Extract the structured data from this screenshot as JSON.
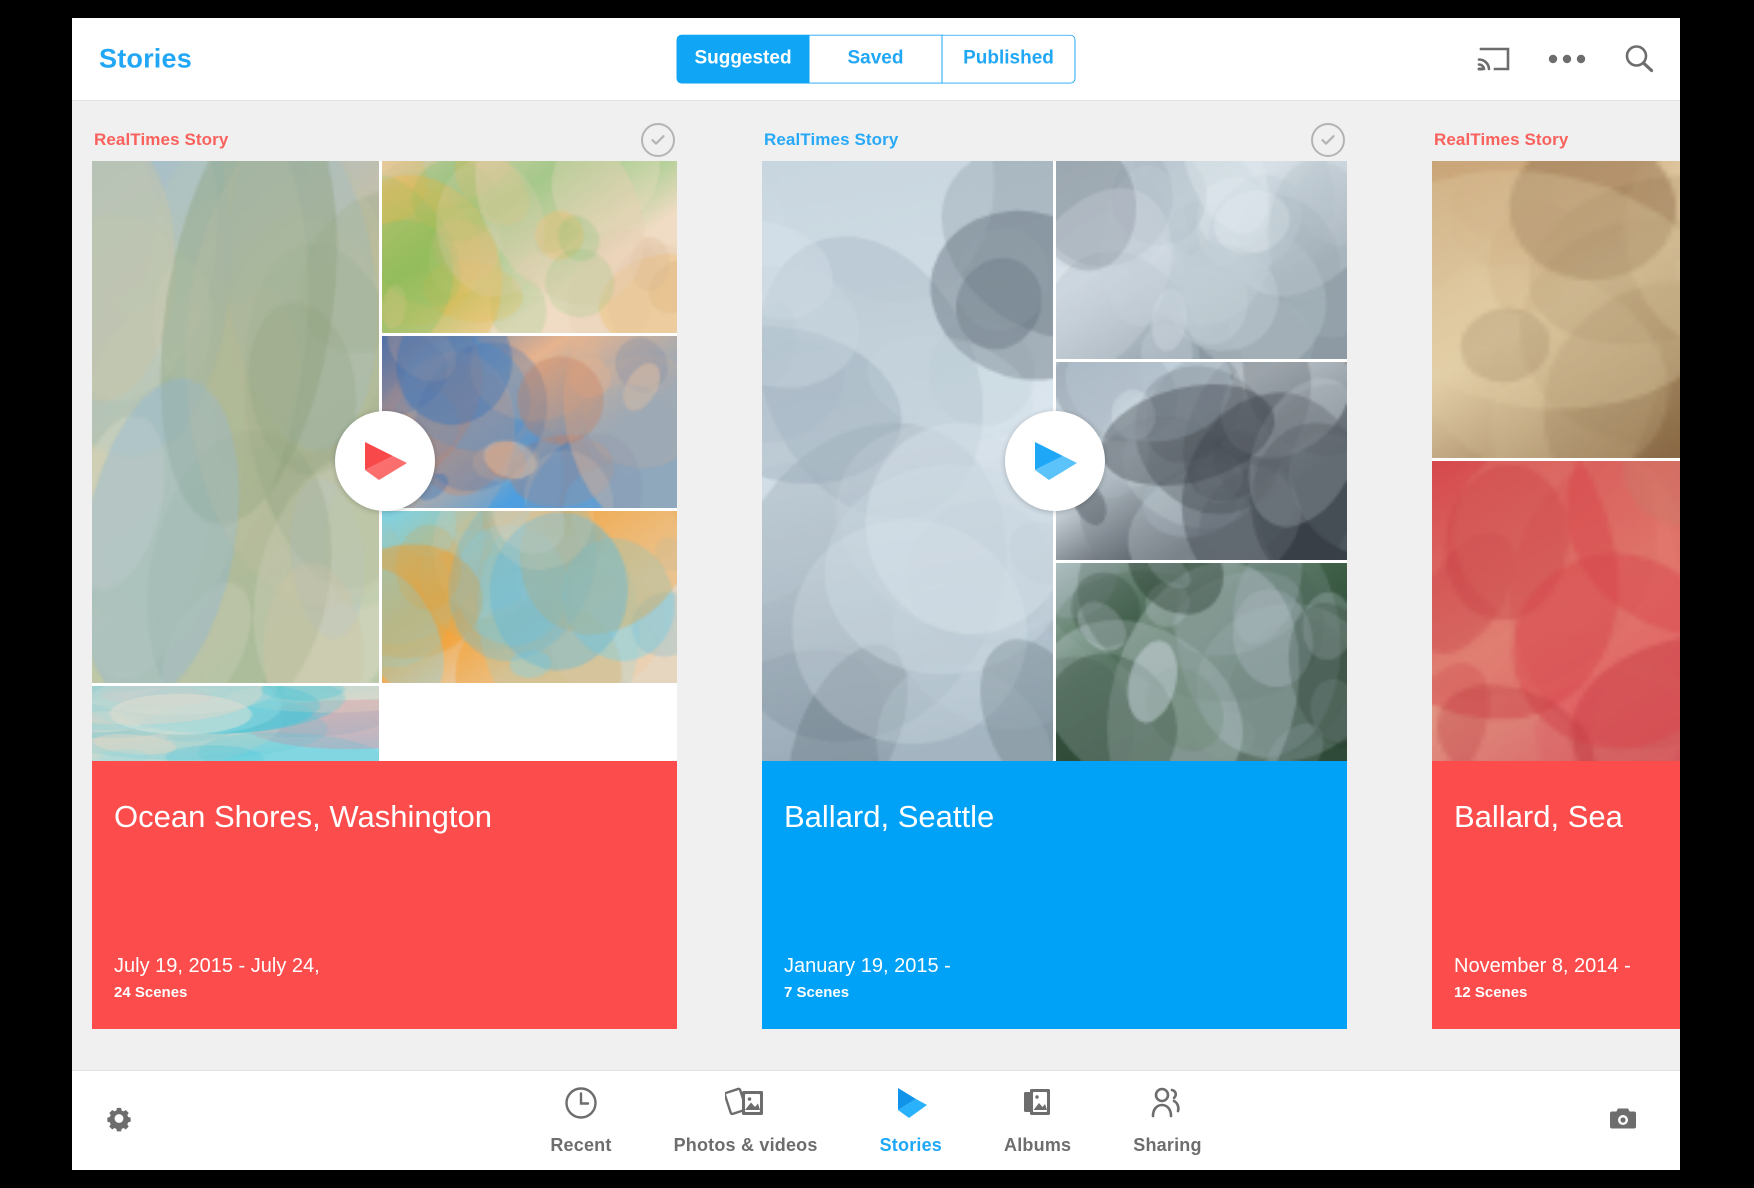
{
  "app": {
    "title": "Stories"
  },
  "tabs": [
    {
      "label": "Suggested",
      "active": true
    },
    {
      "label": "Saved",
      "active": false
    },
    {
      "label": "Published",
      "active": false
    }
  ],
  "appbar_icons": [
    {
      "name": "cast-icon"
    },
    {
      "name": "overflow-menu-icon"
    },
    {
      "name": "search-icon"
    }
  ],
  "colors": {
    "accent_blue": "#10a6f5",
    "title_blue": "#21a7f5",
    "story_red": "#fc4c4c",
    "story_blue": "#00a2f7",
    "kind_red": "#f9615d",
    "kind_blue": "#28a9f7",
    "icon_gray": "#6d6d6d",
    "page_bg": "#f0f0f0"
  },
  "stories": [
    {
      "kind": "RealTimes Story",
      "kind_color": "red",
      "has_check": true,
      "title": "Ocean Shores, Washington",
      "date": "July 19, 2015 - July 24,",
      "scenes": "24 Scenes",
      "caption_color": "red",
      "play_color": "#f9484a",
      "layout": "a",
      "tiles": [
        {
          "name": "beach-houses-dunes-photo",
          "palette": [
            "#8fb6d8",
            "#b9c9a8",
            "#cfc3a4",
            "#e7e0cf",
            "#7f9a74"
          ]
        },
        {
          "name": "girl-building-sandcastle-photo",
          "palette": [
            "#4fc6d8",
            "#8fdbe4",
            "#ead7c4",
            "#f2e5d6",
            "#e88ba0"
          ]
        },
        {
          "name": "sand-toys-bucket-shovel-photo",
          "palette": [
            "#e8cfb4",
            "#f0dcc4",
            "#6fc36a",
            "#f2b33b",
            "#d9b894"
          ]
        },
        {
          "name": "children-swimming-goggles-photo",
          "palette": [
            "#2a6fbf",
            "#4c9fe0",
            "#e8b48e",
            "#f0d0b0",
            "#c97a5a"
          ]
        },
        {
          "name": "kids-snorkels-floaties-photo",
          "palette": [
            "#7fd4e8",
            "#e7d6bf",
            "#f59a22",
            "#f2c79a",
            "#66b8d8"
          ]
        }
      ]
    },
    {
      "kind": "RealTimes Story",
      "kind_color": "blue",
      "has_check": true,
      "title": "Ballard, Seattle",
      "date": "January 19, 2015 -",
      "scenes": "7 Scenes",
      "caption_color": "blue",
      "play_color": "#1ea7f6",
      "layout": "b",
      "tiles": [
        {
          "name": "child-throwing-snowball-photo",
          "palette": [
            "#c8d6e0",
            "#9aabb8",
            "#dce6ee",
            "#5a6a74",
            "#b0bec8"
          ]
        },
        {
          "name": "snowman-with-scarf-photo",
          "palette": [
            "#c4d0d8",
            "#8d9aa3",
            "#e2eaf0",
            "#3f4a52",
            "#aab8c2"
          ]
        },
        {
          "name": "golden-retriever-running-snow-photo",
          "palette": [
            "#dce8f0",
            "#c08a4a",
            "#e8c28a",
            "#b4c6d2",
            "#8e6a3a"
          ]
        },
        {
          "name": "girl-hugging-dog-window-photo",
          "palette": [
            "#b8c8d4",
            "#3a4048",
            "#dce6ec",
            "#7a858e",
            "#545c64"
          ]
        },
        {
          "name": "child-by-pine-tree-snow-photo",
          "palette": [
            "#d4e0e8",
            "#2f4a38",
            "#46684e",
            "#aebcc6",
            "#1f3326"
          ]
        }
      ]
    },
    {
      "kind": "RealTimes Story",
      "kind_color": "red",
      "has_check": false,
      "title": "Ballard, Sea",
      "date": "November 8, 2014 -",
      "scenes": "12 Scenes",
      "caption_color": "red",
      "play_color": "#f9484a",
      "layout": "c",
      "tiles": [
        {
          "name": "family-thanksgiving-dinner-photo",
          "palette": [
            "#c9a478",
            "#8a6a46",
            "#e4cfa8",
            "#6a4e32",
            "#d8b886"
          ]
        },
        {
          "name": "mother-child-winter-hats-photo",
          "palette": [
            "#d8434a",
            "#e8747a",
            "#f0c0a0",
            "#b82f38",
            "#c97a6a"
          ]
        }
      ]
    }
  ],
  "bottom_nav": {
    "gear_icon": "settings-gear-icon",
    "camera_icon": "camera-icon",
    "items": [
      {
        "label": "Recent",
        "icon": "clock-icon",
        "active": false
      },
      {
        "label": "Photos & videos",
        "icon": "photos-stack-icon",
        "active": false
      },
      {
        "label": "Stories",
        "icon": "realtimes-play-icon",
        "active": true
      },
      {
        "label": "Albums",
        "icon": "albums-icon",
        "active": false
      },
      {
        "label": "Sharing",
        "icon": "people-icon",
        "active": false
      }
    ]
  }
}
